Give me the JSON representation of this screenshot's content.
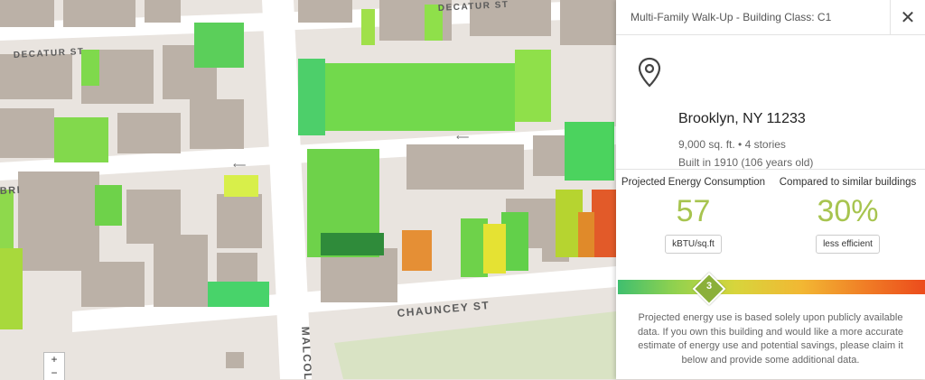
{
  "map": {
    "streets": {
      "decatur_st_top": "DECATUR ST",
      "decatur_st_left": "DECATUR ST",
      "chauncey_st": "CHAUNCEY ST",
      "malcolm": "MALCOL",
      "bri": "BRI"
    },
    "zoom": {
      "in": "+",
      "out": "−"
    }
  },
  "panel": {
    "header_title": "Multi-Family Walk-Up - Building Class: C1",
    "close_label": "✕",
    "address": "Brooklyn, NY 11233",
    "size_stories": "9,000 sq. ft.  •  4 stories",
    "built": "Built in 1910 (106 years old)",
    "energy": {
      "label": "Projected Energy Consumption",
      "value": "57",
      "unit": "kBTU/sq.ft"
    },
    "compare": {
      "label": "Compared to similar buildings",
      "value": "30%",
      "unit": "less efficient"
    },
    "scale_value": "3",
    "disclaimer": "Projected energy use is based solely upon publicly available data. If you own this building and would like a more accurate estimate of energy use and potential savings, please claim it below and provide some additional data."
  },
  "colors": {
    "accent_value": "#a7c44f",
    "marker": "#8bb03a"
  }
}
